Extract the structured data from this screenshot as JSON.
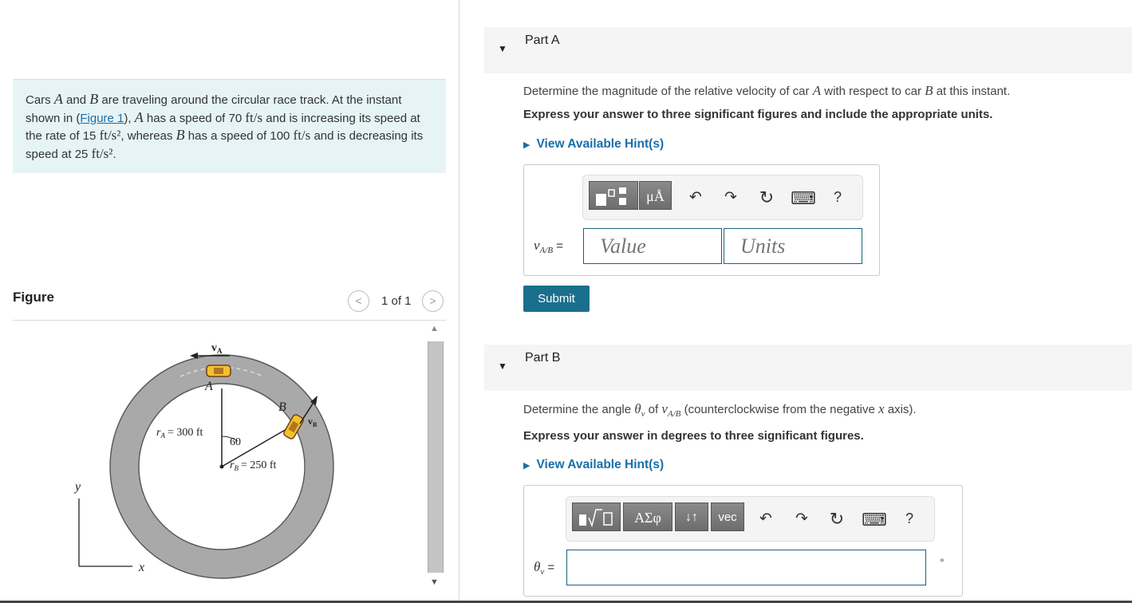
{
  "problem": {
    "t1": "Cars ",
    "a1": "A",
    "t2": " and ",
    "b1": "B",
    "t3": " are traveling around the circular race track. At the instant shown in (",
    "figure_link": "Figure 1",
    "t4": "), ",
    "a2": "A",
    "t5": " has a speed of 70 ",
    "u1": "ft/s",
    "t6": " and is increasing its speed at the rate of 15 ",
    "u2": "ft/s²",
    "t7": ", whereas ",
    "b2": "B",
    "t8": " has a speed of 100 ",
    "u3": "ft/s",
    "t9": " and is decreasing its speed at 25 ",
    "u4": "ft/s²",
    "t10": "."
  },
  "figure": {
    "label": "Figure",
    "pager": "1 of 1",
    "prev": "<",
    "next": ">",
    "labels": {
      "va": "v",
      "va_sub": "A",
      "a": "A",
      "b": "B",
      "vb": "v",
      "vb_sub": "B",
      "ra": "r",
      "ra_sub": "A",
      "ra_val": "= 300 ft",
      "angle": "60",
      "rb": "r",
      "rb_sub": "B",
      "rb_val": "= 250 ft",
      "y": "y",
      "x": "x"
    }
  },
  "partA": {
    "caret": "▼",
    "title": "Part A",
    "q1": "Determine the magnitude of the relative velocity of car ",
    "qa": "A",
    "q2": " with respect to car ",
    "qb": "B",
    "q3": " at this instant.",
    "instr": "Express your answer to three significant figures and include the appropriate units.",
    "hint": "View Available Hint(s)",
    "var": "v",
    "var_sub": "A/B",
    "eq": "=",
    "value_placeholder": "Value",
    "units_placeholder": "Units",
    "submit": "Submit",
    "tb_units": "μÅ",
    "tb_help": "?"
  },
  "partB": {
    "caret": "▼",
    "title": "Part B",
    "q1": "Determine the angle ",
    "theta": "θ",
    "theta_sub": "v",
    "q2": " of ",
    "v": "v",
    "v_sub": "A/B",
    "q3": " (counterclockwise from the negative ",
    "x": "x",
    "q4": " axis).",
    "instr": "Express your answer in degrees to three significant figures.",
    "hint": "View Available Hint(s)",
    "var": "θ",
    "var_sub": "v",
    "eq": "=",
    "tb_greek": "ΑΣφ",
    "tb_arrows": "↓↑",
    "tb_vec": "vec",
    "tb_help": "?",
    "degree": "°"
  },
  "icons": {
    "undo": "↶",
    "redo": "↷",
    "reset": "↻",
    "keyboard": "⌨"
  },
  "colors": {
    "link": "#1a6fa8",
    "submit": "#1a6f8c",
    "problem_bg": "#e6f4f6",
    "track": "#a9a9a9"
  }
}
